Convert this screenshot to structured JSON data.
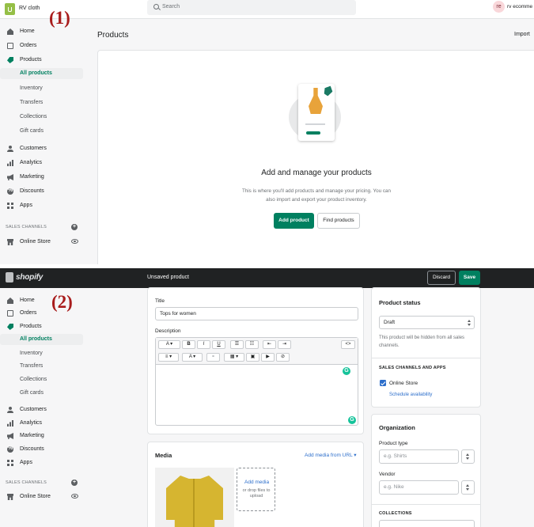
{
  "panel1": {
    "step_label": "(1)",
    "store_name": "RV cloth",
    "search_placeholder": "Search",
    "avatar_initials": "re",
    "account_name": "rv ecomme",
    "nav": {
      "home": "Home",
      "orders": "Orders",
      "products": "Products",
      "all_products": "All products",
      "inventory": "Inventory",
      "transfers": "Transfers",
      "collections": "Collections",
      "gift_cards": "Gift cards",
      "customers": "Customers",
      "analytics": "Analytics",
      "marketing": "Marketing",
      "discounts": "Discounts",
      "apps": "Apps",
      "sales_channels": "SALES CHANNELS",
      "online_store": "Online Store"
    },
    "page_title": "Products",
    "import_label": "Import",
    "empty_state": {
      "heading": "Add and manage your products",
      "description": "This is where you'll add products and manage your pricing. You can also import and export your product inventory.",
      "add_button": "Add product",
      "find_button": "Find products"
    }
  },
  "panel2": {
    "step_label": "(2)",
    "brand": "shopify",
    "title": "Unsaved product",
    "discard_label": "Discard",
    "save_label": "Save",
    "nav": {
      "home": "Home",
      "orders": "Orders",
      "products": "Products",
      "all_products": "All products",
      "inventory": "Inventory",
      "transfers": "Transfers",
      "collections": "Collections",
      "gift_cards": "Gift cards",
      "customers": "Customers",
      "analytics": "Analytics",
      "marketing": "Marketing",
      "discounts": "Discounts",
      "apps": "Apps",
      "sales_channels": "SALES CHANNELS",
      "online_store": "Online Store"
    },
    "form": {
      "title_label": "Title",
      "title_value": "Tops for women",
      "description_label": "Description",
      "toolbar": {
        "font": "A ▾",
        "bold": "B",
        "italic": "I",
        "underline": "U",
        "bullets": "☰",
        "numbers": "☷",
        "outdent": "⇤",
        "indent": "⇥",
        "html": "<>",
        "align": "≡ ▾",
        "color": "A ▾",
        "link": "⚭",
        "table": "▦ ▾",
        "image": "▣",
        "video": "▶",
        "clear": "⊘"
      },
      "grammarly": "G",
      "media_heading": "Media",
      "add_media_url": "Add media from URL ▾",
      "add_media": "Add media",
      "drop_hint": "or drop files to upload"
    },
    "status": {
      "heading": "Product status",
      "value": "Draft",
      "note": "This product will be hidden from all sales channels.",
      "channels_heading": "SALES CHANNELS AND APPS",
      "online_store": "Online Store",
      "schedule": "Schedule availability"
    },
    "organization": {
      "heading": "Organization",
      "type_label": "Product type",
      "type_placeholder": "e.g. Shirts",
      "vendor_label": "Vendor",
      "vendor_placeholder": "e.g. Nike",
      "collections_heading": "COLLECTIONS"
    }
  },
  "colors": {
    "accent": "#008060",
    "link": "#2c6ecb",
    "step_label": "#a81c1c",
    "topbar_dark": "#202223"
  }
}
